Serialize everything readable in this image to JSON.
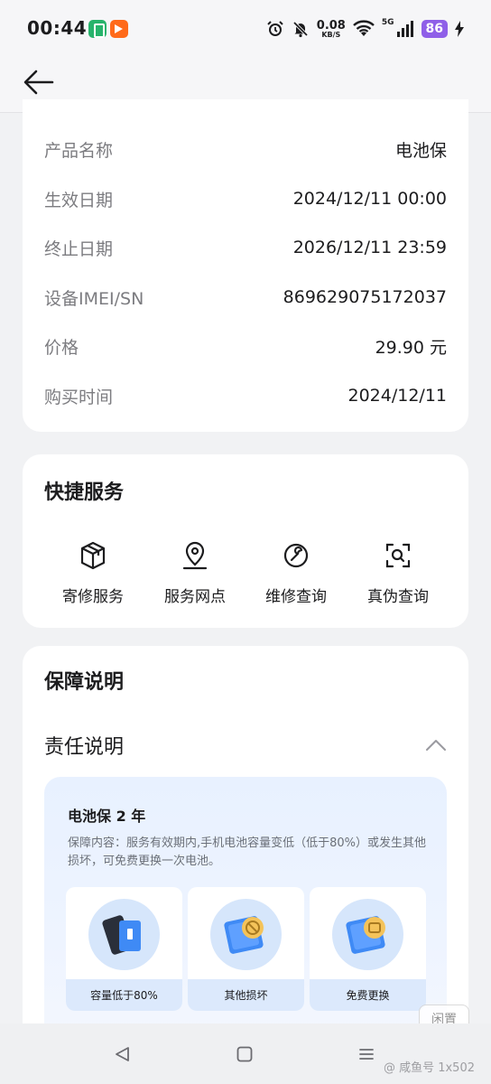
{
  "status_bar": {
    "time": "00:44",
    "speed_value": "0.08",
    "speed_unit": "KB/S",
    "network": "5G",
    "battery": "86"
  },
  "product_info": {
    "rows": [
      {
        "label": "产品名称",
        "value": "电池保"
      },
      {
        "label": "生效日期",
        "value": "2024/12/11 00:00"
      },
      {
        "label": "终止日期",
        "value": "2026/12/11 23:59"
      },
      {
        "label": "设备IMEI/SN",
        "value": "869629075172037"
      },
      {
        "label": "价格",
        "value": "29.90 元"
      },
      {
        "label": "购买时间",
        "value": "2024/12/11"
      }
    ]
  },
  "quick_services": {
    "title": "快捷服务",
    "items": [
      {
        "label": "寄修服务",
        "icon": "box-icon"
      },
      {
        "label": "服务网点",
        "icon": "location-pin-icon"
      },
      {
        "label": "维修查询",
        "icon": "wrench-icon"
      },
      {
        "label": "真伪查询",
        "icon": "scan-icon"
      }
    ]
  },
  "guarantee": {
    "title": "保障说明",
    "responsibility_title": "责任说明",
    "panel_title": "电池保 2 年",
    "panel_desc": "保障内容：服务有效期内,手机电池容量变低（低于80%）或发生其他损坏，可免费更换一次电池。",
    "tiles": [
      {
        "label": "容量低于80%",
        "icon": "phone-battery-icon"
      },
      {
        "label": "其他损坏",
        "icon": "damage-icon"
      },
      {
        "label": "免费更换",
        "icon": "free-replace-icon"
      }
    ]
  },
  "watermark": {
    "logo": "闲置",
    "text": "@ 咸鱼号 1x502"
  },
  "colors": {
    "accent": "#1a6cf0",
    "battery_badge": "#8f5fe8",
    "panel_bg": "#e8f1ff"
  }
}
